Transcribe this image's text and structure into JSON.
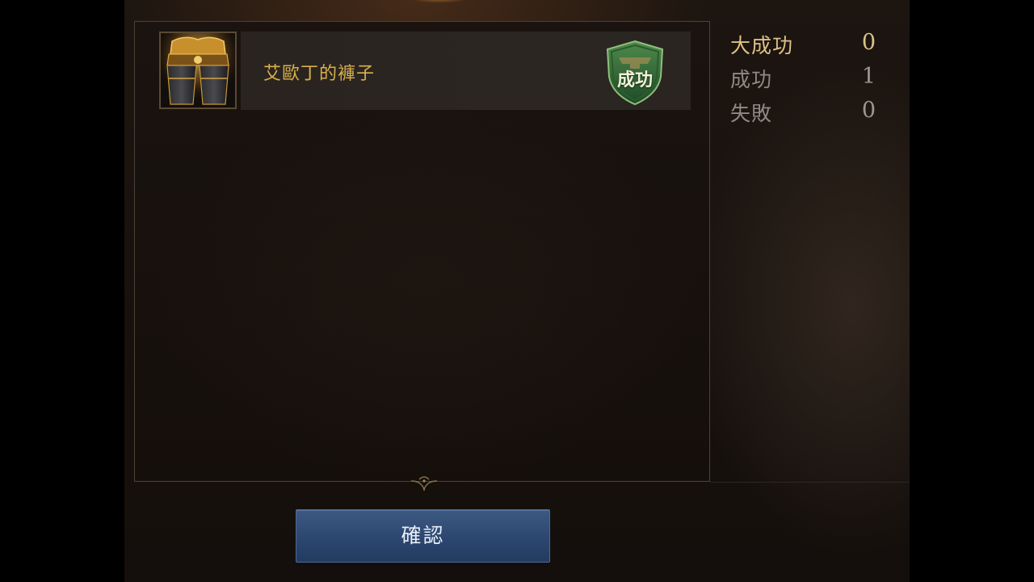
{
  "item": {
    "name": "艾歐丁的褲子",
    "result_badge": "成功",
    "icon": "golden-pants-icon"
  },
  "stats": [
    {
      "label": "大成功",
      "value": "0",
      "highlight": true
    },
    {
      "label": "成功",
      "value": "1",
      "highlight": false
    },
    {
      "label": "失敗",
      "value": "0",
      "highlight": false
    }
  ],
  "confirm_button": {
    "label": "確認"
  },
  "colors": {
    "item_name": "#d9b04a",
    "badge_green": "#2f6b35",
    "button_blue": "#2c4670",
    "highlight_gold": "#dcc285"
  }
}
